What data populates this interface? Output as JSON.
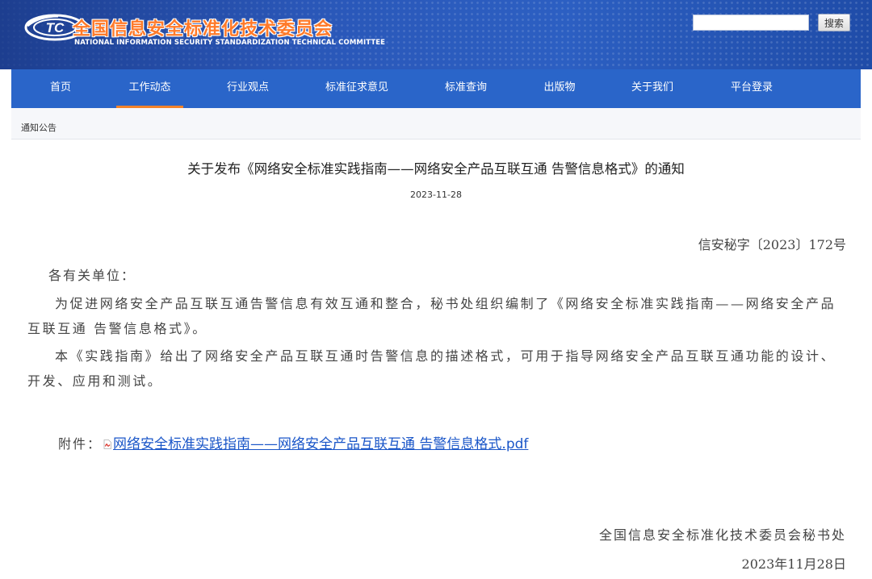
{
  "header": {
    "site_title": "全国信息安全标准化技术委员会",
    "site_subtitle": "NATIONAL INFORMATION SECURITY STANDARDIZATION TECHNICAL COMMITTEE",
    "logo_text": "TC",
    "search": {
      "placeholder": "",
      "button_label": "搜索"
    }
  },
  "nav": {
    "items": [
      {
        "label": "首页"
      },
      {
        "label": "工作动态",
        "active": true
      },
      {
        "label": "行业观点"
      },
      {
        "label": "标准征求意见"
      },
      {
        "label": "标准查询"
      },
      {
        "label": "出版物"
      },
      {
        "label": "关于我们"
      },
      {
        "label": "平台登录"
      }
    ]
  },
  "breadcrumb": {
    "label": "通知公告"
  },
  "article": {
    "title": "关于发布《网络安全标准实践指南——网络安全产品互联互通 告警信息格式》的通知",
    "date": "2023-11-28",
    "doc_number": "信安秘字〔2023〕172号",
    "salutation": "各有关单位：",
    "paragraphs": [
      "为促进网络安全产品互联互通告警信息有效互通和整合，秘书处组织编制了《网络安全标准实践指南——网络安全产品互联互通 告警信息格式》。",
      "本《实践指南》给出了网络安全产品互联互通时告警信息的描述格式，可用于指导网络安全产品互联互通功能的设计、开发、应用和测试。"
    ],
    "attachment": {
      "label": "附件：",
      "icon": "pdf-file-icon",
      "link_text": "网络安全标准实践指南——网络安全产品互联互通 告警信息格式.pdf"
    },
    "signature": {
      "org": "全国信息安全标准化技术委员会秘书处",
      "date": "2023年11月28日"
    }
  },
  "colors": {
    "banner_blue": "#2a57b8",
    "nav_blue": "#2a65c9",
    "active_underline": "#f2822a",
    "title_orange": "#ff7a2a",
    "link_blue": "#1a56c8"
  }
}
